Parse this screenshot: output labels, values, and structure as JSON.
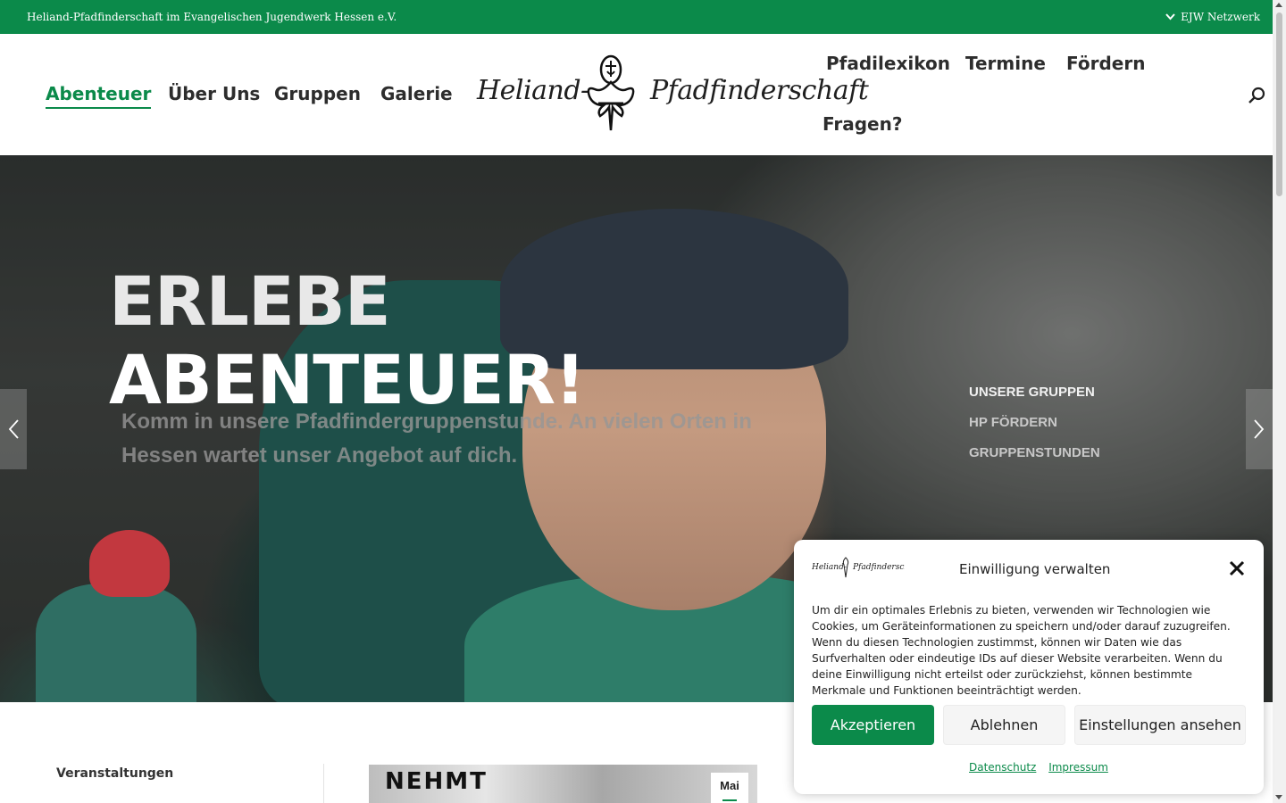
{
  "topbar": {
    "org_name": "Heliand-Pfadfinderschaft im Evangelischen Jugendwerk Hessen e.V.",
    "network_label": "EJW Netzwerk",
    "bg_color": "#0b8a4a"
  },
  "nav": {
    "left_items": [
      {
        "label": "Abenteuer",
        "active": true
      },
      {
        "label": "Über Uns"
      },
      {
        "label": "Gruppen"
      },
      {
        "label": "Galerie"
      }
    ],
    "right_items": [
      {
        "label": "Pfadilexikon"
      },
      {
        "label": "Termine"
      },
      {
        "label": "Fördern"
      },
      {
        "label": "Fragen?"
      }
    ],
    "logo_left": "Heliand-",
    "logo_right": "Pfadfinderschaft",
    "search_icon": "search-icon"
  },
  "hero": {
    "title_line1": "ERLEBE",
    "title_line2": "ABENTEUER!",
    "subtitle": "Komm in unsere Pfadfindergruppenstunde. An vielen Orten in Hessen wartet unser Angebot auf dich.",
    "links": [
      "UNSERE GRUPPEN",
      "HP FÖRDERN",
      "GRUPPENSTUNDEN"
    ],
    "prev_icon": "chevron-left-icon",
    "next_icon": "chevron-right-icon"
  },
  "below": {
    "events_label": "Veranstaltungen",
    "card_banner_text": "NEHMT",
    "date_badge": "Mai"
  },
  "consent": {
    "title": "Einwilligung verwalten",
    "text": "Um dir ein optimales Erlebnis zu bieten, verwenden wir Technologien wie Cookies, um Geräteinformationen zu speichern und/oder darauf zuzugreifen. Wenn du diesen Technologien zustimmst, können wir Daten wie das Surfverhalten oder eindeutige IDs auf dieser Website verarbeiten. Wenn du deine Einwilligung nicht erteilst oder zurückziehst, können bestimmte Merkmale und Funktionen beeinträchtigt werden.",
    "accept_label": "Akzeptieren",
    "deny_label": "Ablehnen",
    "prefs_label": "Einstellungen ansehen",
    "privacy_link": "Datenschutz",
    "imprint_link": "Impressum",
    "accent_color": "#0b8a4a"
  }
}
